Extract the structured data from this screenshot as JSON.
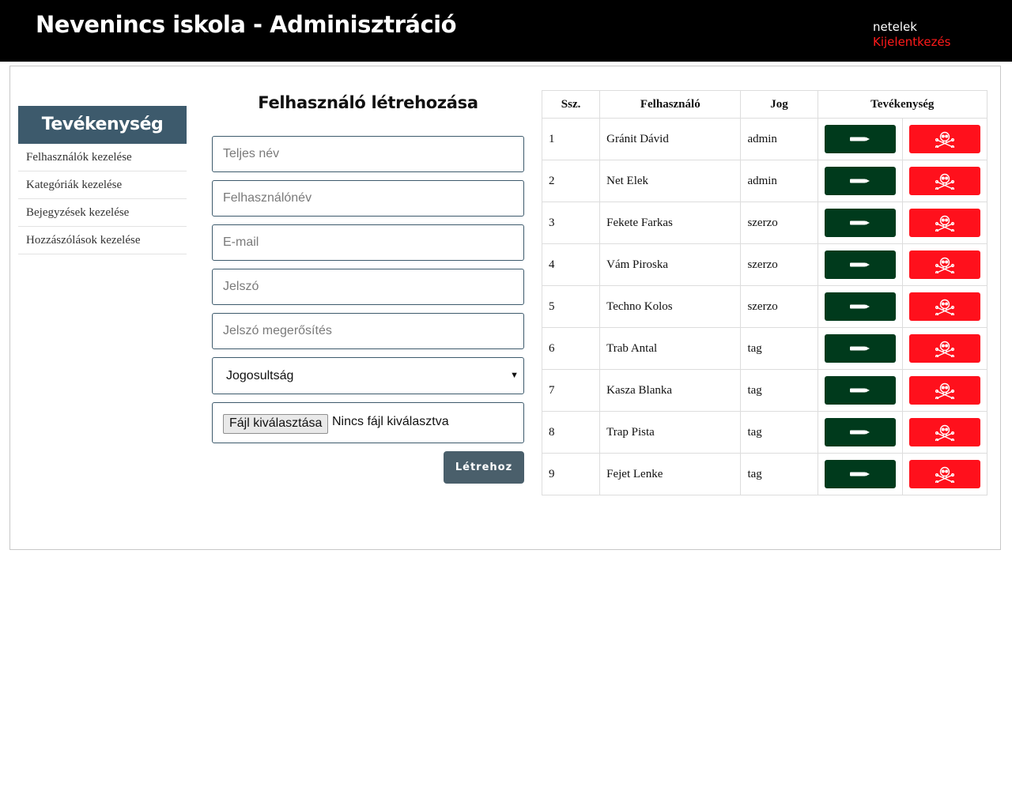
{
  "header": {
    "site_title": "Nevenincs iskola - Adminisztráció",
    "user_name": "netelek",
    "logout_label": "Kijelentkezés"
  },
  "sidebar": {
    "heading": "Tevékenység",
    "items": [
      {
        "label": "Felhasználók kezelése"
      },
      {
        "label": "Kategóriák kezelése"
      },
      {
        "label": "Bejegyzések kezelése"
      },
      {
        "label": "Hozzászólások kezelése"
      }
    ]
  },
  "form": {
    "title": "Felhasználó létrehozása",
    "fullname_placeholder": "Teljes név",
    "username_placeholder": "Felhasználónév",
    "email_placeholder": "E-mail",
    "password_placeholder": "Jelszó",
    "password_confirm_placeholder": "Jelszó megerősítés",
    "role_select": "Jogosultság",
    "file_button_label": "Fájl kiválasztása",
    "file_status": "Nincs fájl kiválasztva",
    "submit_label": "Létrehoz"
  },
  "table": {
    "headers": {
      "num": "Ssz.",
      "user": "Felhasználó",
      "role": "Jog",
      "actions": "Tevékenység"
    },
    "rows": [
      {
        "num": "1",
        "user": "Gránit Dávid",
        "role": "admin"
      },
      {
        "num": "2",
        "user": "Net Elek",
        "role": "admin"
      },
      {
        "num": "3",
        "user": "Fekete Farkas",
        "role": "szerzo"
      },
      {
        "num": "4",
        "user": "Vám Piroska",
        "role": "szerzo"
      },
      {
        "num": "5",
        "user": "Techno Kolos",
        "role": "szerzo"
      },
      {
        "num": "6",
        "user": "Trab Antal",
        "role": "tag"
      },
      {
        "num": "7",
        "user": "Kasza Blanka",
        "role": "tag"
      },
      {
        "num": "8",
        "user": "Trap Pista",
        "role": "tag"
      },
      {
        "num": "9",
        "user": "Fejet Lenke",
        "role": "tag"
      }
    ],
    "edit_icon": "pencil-icon",
    "delete_icon": "skull-crossbones-icon"
  },
  "colors": {
    "header_bg": "#000000",
    "logout": "#ff1a1a",
    "sidebar_heading_bg": "#3d5a6c",
    "edit_button": "#003a1c",
    "delete_button": "#ff101c",
    "submit_button": "#4a5f6b"
  }
}
